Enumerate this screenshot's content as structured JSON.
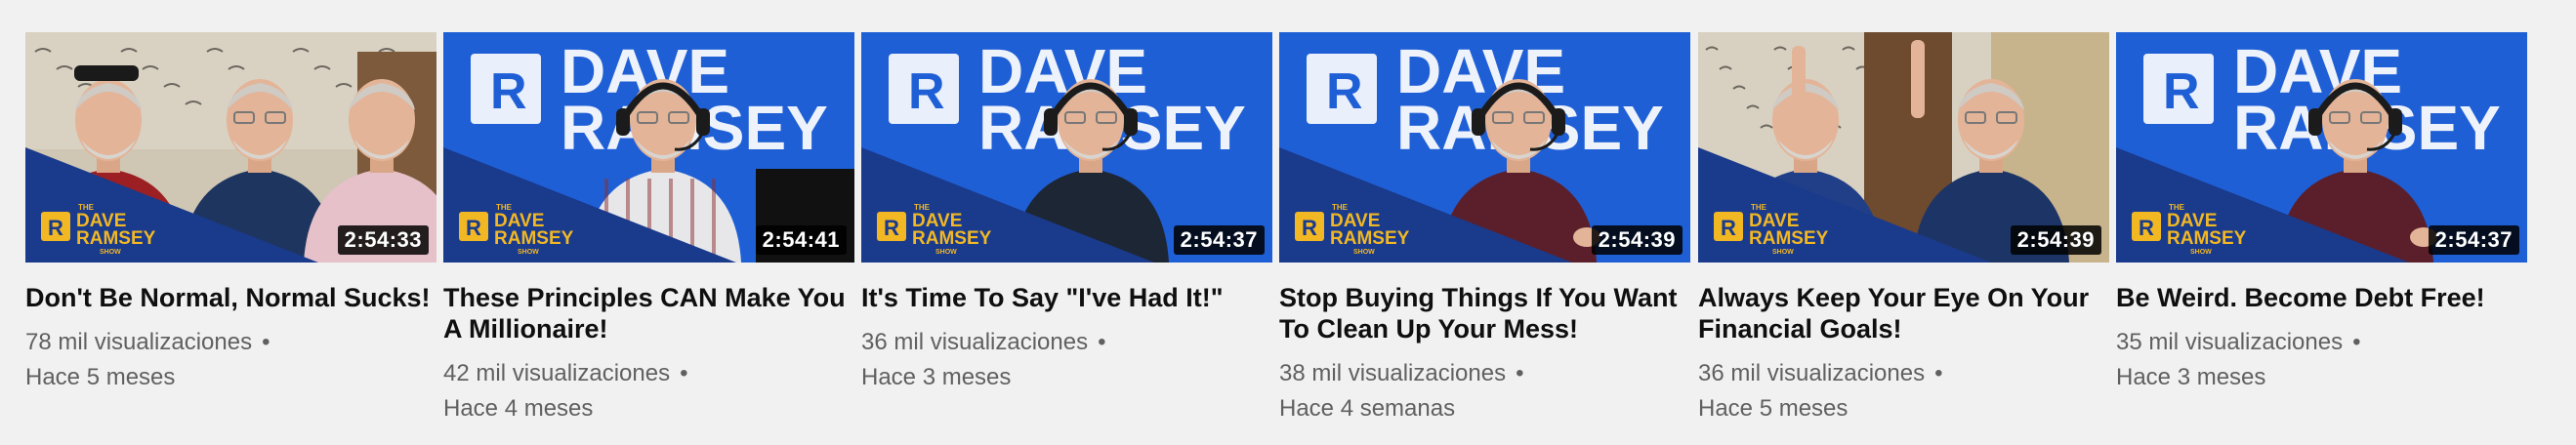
{
  "videos": [
    {
      "title": "Don't Be Normal, Normal Sucks!",
      "duration": "2:54:33",
      "views": "78 mil visualizaciones",
      "age": "Hace 5 meses",
      "scene": "group"
    },
    {
      "title": "These Principles CAN Make You A Millionaire!",
      "duration": "2:54:41",
      "views": "42 mil visualizaciones",
      "age": "Hace 4 meses",
      "scene": "studio-left"
    },
    {
      "title": "It's Time To Say \"I've Had It!\"",
      "duration": "2:54:37",
      "views": "36 mil visualizaciones",
      "age": "Hace 3 meses",
      "scene": "studio-mid"
    },
    {
      "title": "Stop Buying Things If You Want To Clean Up Your Mess!",
      "duration": "2:54:39",
      "views": "38 mil visualizaciones",
      "age": "Hace 4 semanas",
      "scene": "studio-right"
    },
    {
      "title": "Always Keep Your Eye On Your Financial Goals!",
      "duration": "2:54:39",
      "views": "36 mil visualizaciones",
      "age": "Hace 5 meses",
      "scene": "highfive"
    },
    {
      "title": "Be Weird. Become Debt Free!",
      "duration": "2:54:37",
      "views": "35 mil visualizaciones",
      "age": "Hace 3 meses",
      "scene": "studio-right"
    }
  ],
  "separator": "•",
  "brand": {
    "logo_small_top": "THE",
    "logo_line1": "DAVE",
    "logo_line2": "RAMSEY",
    "logo_small_bottom": "SHOW",
    "letter": "R",
    "colors": {
      "blue": "#1f5fd6",
      "navy": "#1a3a8c",
      "gold": "#f2b824",
      "bg": "#f1f1f1"
    }
  }
}
